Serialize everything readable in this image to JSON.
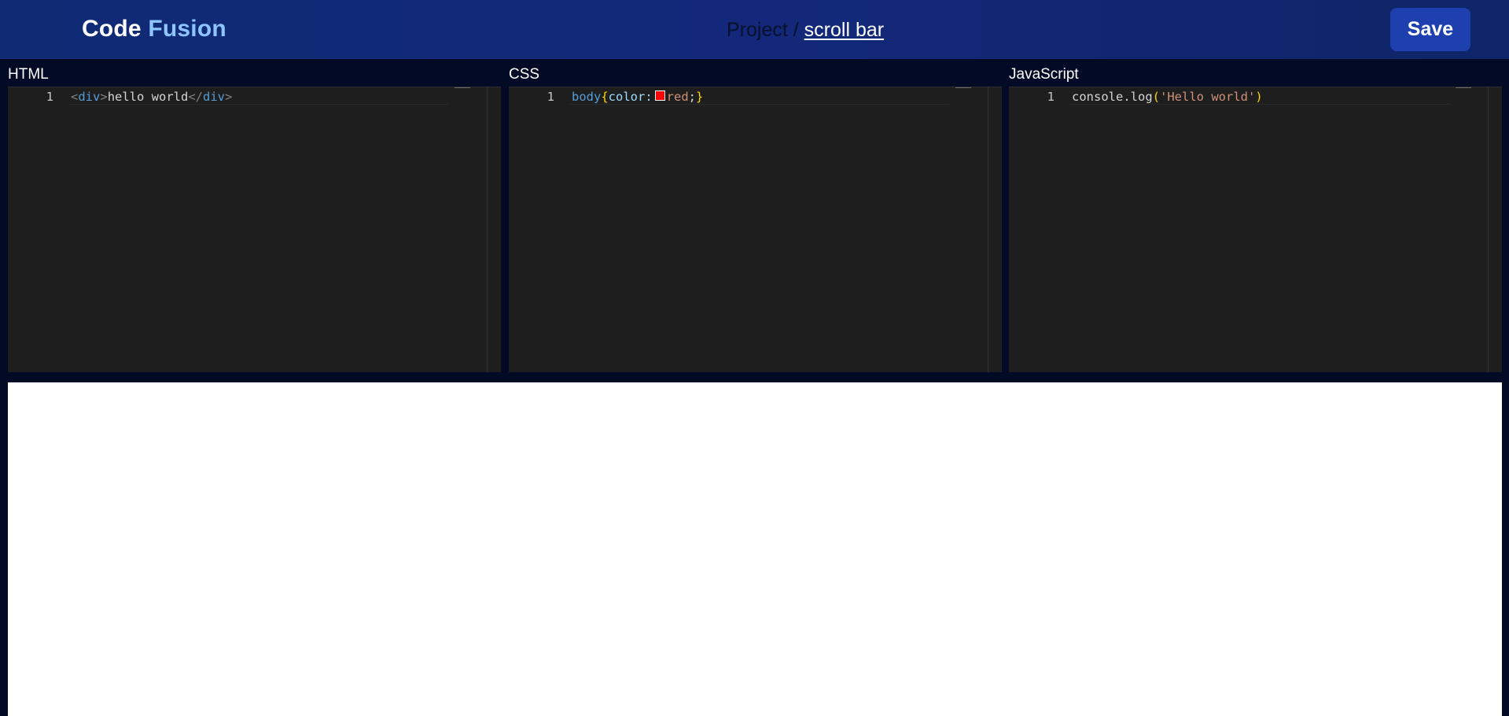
{
  "header": {
    "brand_first": "Code",
    "brand_second": "Fusion",
    "breadcrumb_prefix": "Project /",
    "project_name": "scroll bar",
    "save_label": "Save",
    "colors": {
      "header_bg": "#13287a",
      "brand_accent": "#8ec5ff",
      "save_bg": "#1e3fae"
    }
  },
  "editors": {
    "html": {
      "title": "HTML",
      "line_number": "1",
      "tokens": {
        "open_lt": "<",
        "open_tag": "div",
        "open_gt": ">",
        "text": "hello world",
        "close_lt": "</",
        "close_tag": "div",
        "close_gt": ">"
      }
    },
    "css": {
      "title": "CSS",
      "line_number": "1",
      "tokens": {
        "selector": "body",
        "open_brace": "{",
        "property": "color:",
        "value": "red",
        "semicolon": ";",
        "close_brace": "}"
      },
      "swatch_color": "#ff0000"
    },
    "js": {
      "title": "JavaScript",
      "line_number": "1",
      "tokens": {
        "call": "console.log",
        "open_paren": "(",
        "string": "'Hello world'",
        "close_paren": ")"
      }
    }
  },
  "preview": {
    "background": "#ffffff"
  }
}
